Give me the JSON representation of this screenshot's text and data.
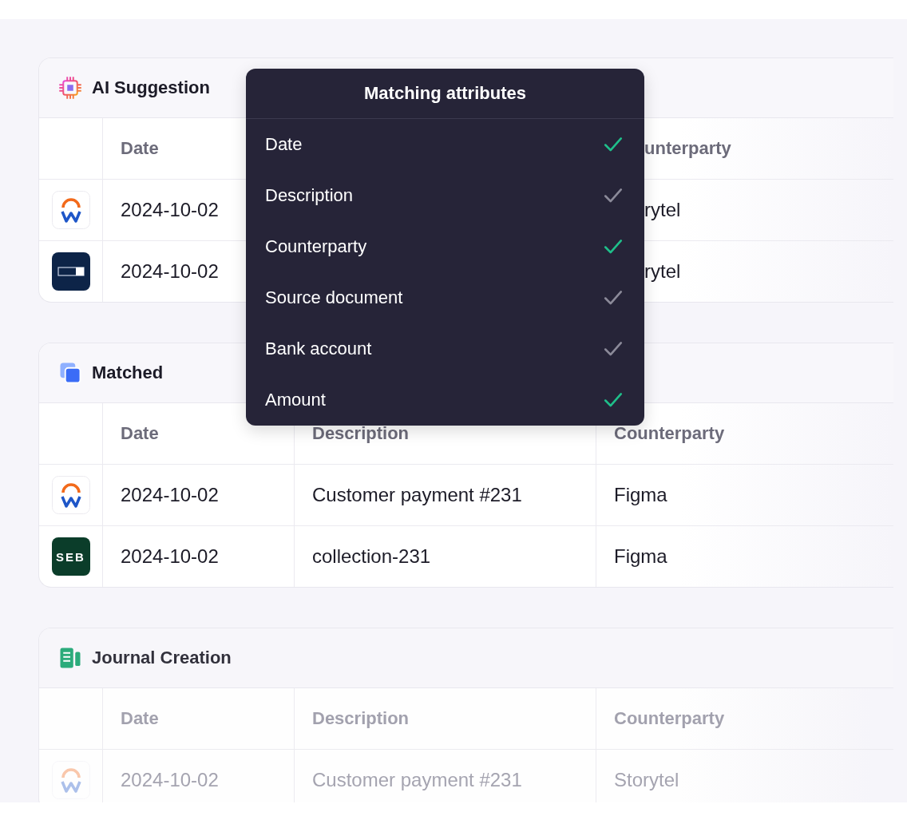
{
  "sections": [
    {
      "kind": "ai",
      "title": "AI Suggestion",
      "faded": false,
      "covered": true,
      "columns": [
        "Date",
        "",
        "unterparty"
      ],
      "rows": [
        {
          "kind": "workday",
          "cells": [
            "2024-10-02",
            "",
            "rytel"
          ]
        },
        {
          "kind": "toggle",
          "cells": [
            "2024-10-02",
            "",
            "rytel"
          ]
        }
      ]
    },
    {
      "kind": "matched",
      "title": "Matched",
      "faded": false,
      "covered": false,
      "columns": [
        "Date",
        "Description",
        "Counterparty"
      ],
      "rows": [
        {
          "kind": "workday",
          "cells": [
            "2024-10-02",
            "Customer payment #231",
            "Figma"
          ]
        },
        {
          "kind": "seb",
          "logo_text": "SEB",
          "cells": [
            "2024-10-02",
            "collection-231",
            "Figma"
          ]
        }
      ]
    },
    {
      "kind": "journal",
      "title": "Journal Creation",
      "faded": true,
      "covered": false,
      "columns": [
        "Date",
        "Description",
        "Counterparty"
      ],
      "rows": [
        {
          "kind": "workday",
          "cells": [
            "2024-10-02",
            "Customer payment #231",
            "Storytel"
          ]
        }
      ]
    }
  ],
  "popup": {
    "title": "Matching attributes",
    "items": [
      {
        "label": "Date",
        "matched": true
      },
      {
        "label": "Description",
        "matched": false
      },
      {
        "label": "Counterparty",
        "matched": true
      },
      {
        "label": "Source document",
        "matched": false
      },
      {
        "label": "Bank account",
        "matched": false
      },
      {
        "label": "Amount",
        "matched": true
      }
    ]
  }
}
